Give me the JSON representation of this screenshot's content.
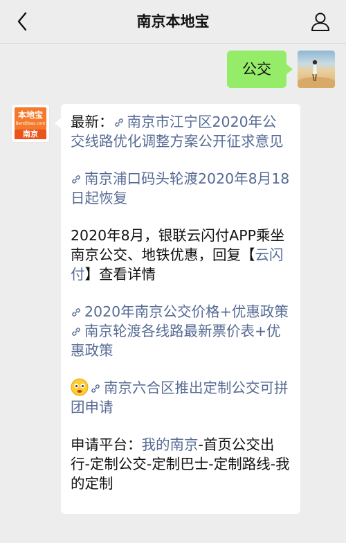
{
  "header": {
    "title": "南京本地宝"
  },
  "messages": {
    "outgoing": {
      "text": "公交"
    },
    "incoming": {
      "logo_brand": "本地宝",
      "logo_site": "Bendibao.com",
      "logo_city": "南京",
      "p1_prefix": "最新：",
      "p1_link": "南京市江宁区2020年公交线路优化调整方案公开征求意见",
      "p2_link": "南京浦口码头轮渡2020年8月18日起恢复",
      "p3_text_before": "2020年8月，银联云闪付APP乘坐南京公交、地铁优惠，回复【",
      "p3_highlight": "云闪付",
      "p3_text_after": "】查看详情",
      "p4_link1": "2020年南京公交价格+优惠政策",
      "p4_link2": "南京轮渡各线路最新票价表+优惠政策",
      "p5_link": "南京六合区推出定制公交可拼团申请",
      "p6_prefix": "申请平台：",
      "p6_link": "我的南京",
      "p6_suffix": "-首页公交出行-定制公交-定制巴士-定制路线-我的定制"
    }
  },
  "colors": {
    "link": "#576b95",
    "outgoing_bubble": "#95ec69",
    "background": "#ededed"
  },
  "icons": {
    "back": "chevron-left-icon",
    "profile": "person-icon",
    "link": "link-icon",
    "emoji": "smiley-emoji-icon"
  }
}
